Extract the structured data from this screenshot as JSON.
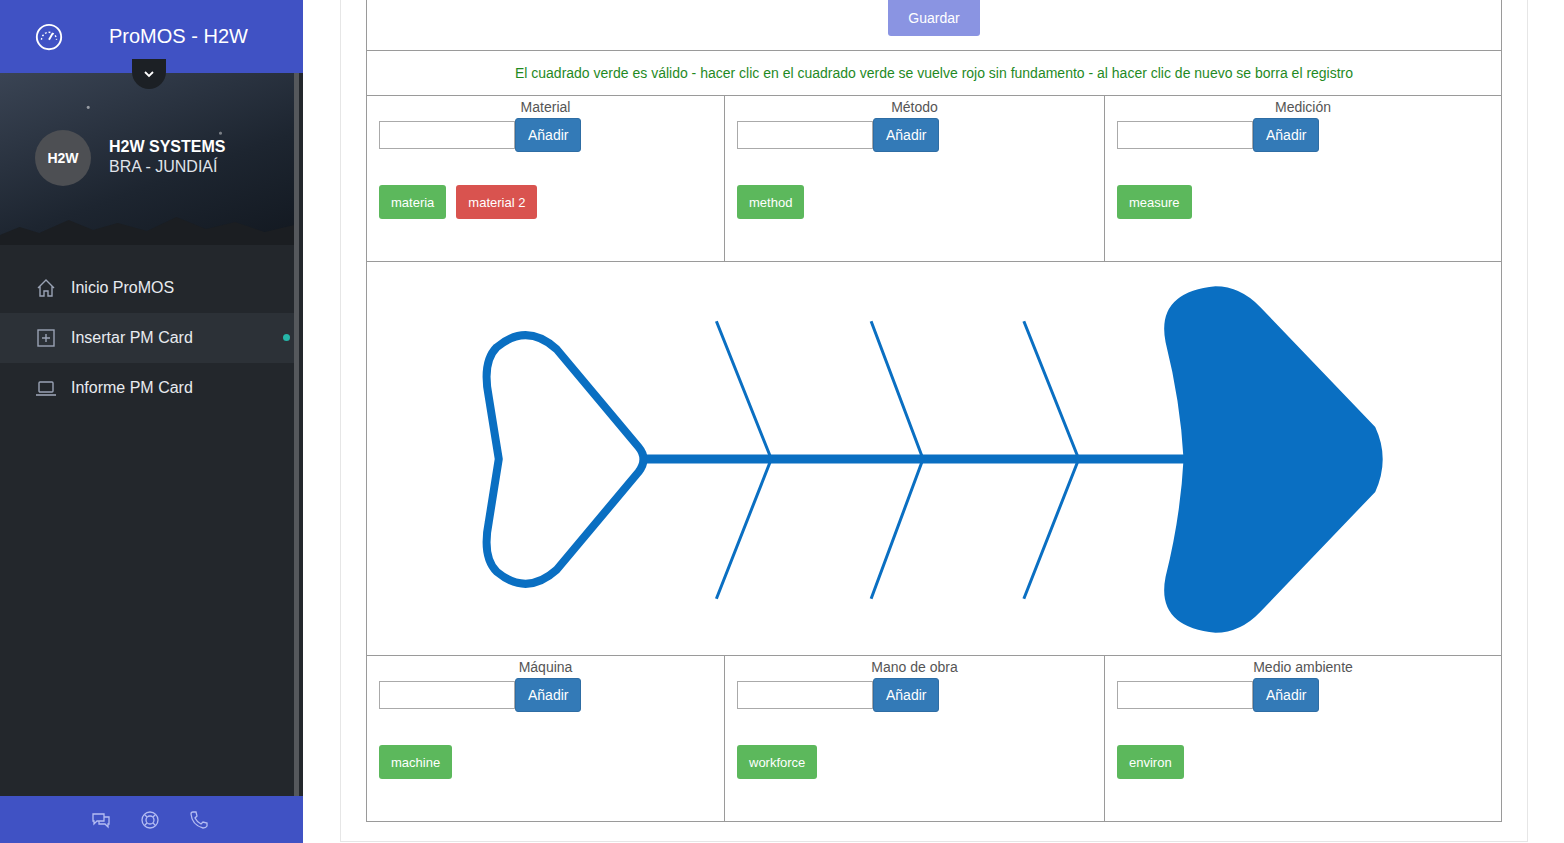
{
  "app": {
    "title": "ProMOS - H2W"
  },
  "profile": {
    "avatar": "H2W",
    "company": "H2W SYSTEMS",
    "location": "BRA - JUNDIAÍ"
  },
  "sidebar": {
    "items": [
      {
        "label": "Inicio ProMOS",
        "selected": false
      },
      {
        "label": "Insertar PM Card",
        "selected": true
      },
      {
        "label": "Informe PM Card",
        "selected": false
      }
    ]
  },
  "save_button": "Guardar",
  "instructions": "El cuadrado verde es válido - hacer clic en el cuadrado verde se vuelve rojo sin fundamento - al hacer clic de nuevo se borra el registro",
  "categories_top": [
    {
      "name": "Material",
      "input_value": "",
      "button": "Añadir",
      "tags": [
        {
          "label": "materia",
          "valid": true
        },
        {
          "label": "material 2",
          "valid": false
        }
      ]
    },
    {
      "name": "Método",
      "input_value": "",
      "button": "Añadir",
      "tags": [
        {
          "label": "method",
          "valid": true
        }
      ]
    },
    {
      "name": "Medición",
      "input_value": "",
      "button": "Añadir",
      "tags": [
        {
          "label": "measure",
          "valid": true
        }
      ]
    }
  ],
  "categories_bottom": [
    {
      "name": "Máquina",
      "input_value": "",
      "button": "Añadir",
      "tags": [
        {
          "label": "machine",
          "valid": true
        }
      ]
    },
    {
      "name": "Mano de obra",
      "input_value": "",
      "button": "Añadir",
      "tags": [
        {
          "label": "workforce",
          "valid": true
        }
      ]
    },
    {
      "name": "Medio ambiente",
      "input_value": "",
      "button": "Añadir",
      "tags": [
        {
          "label": "environ",
          "valid": true
        }
      ]
    }
  ]
}
